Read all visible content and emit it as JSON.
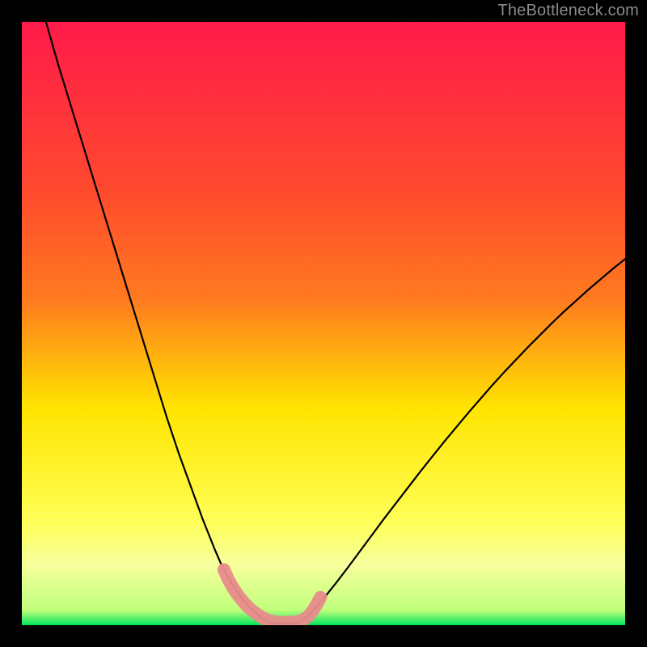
{
  "watermark": "TheBottleneck.com",
  "colors": {
    "bg": "#000000",
    "grad_top": "#ff1a4a",
    "grad_mid1": "#ff7a1f",
    "grad_mid2": "#ffe400",
    "grad_low": "#f6ff9a",
    "grad_bottom": "#00e55a",
    "curve": "#000000",
    "marker": "#e98b8b"
  },
  "chart_data": {
    "type": "line",
    "title": "",
    "xlabel": "",
    "ylabel": "",
    "xlim": [
      0,
      100
    ],
    "ylim": [
      0,
      100
    ],
    "series": [
      {
        "name": "left-curve",
        "x": [
          4,
          6,
          8,
          10,
          12,
          14,
          16,
          18,
          20,
          22,
          24,
          26,
          28,
          30,
          32,
          33,
          34,
          35,
          36,
          37,
          38,
          39,
          40,
          41
        ],
        "y": [
          100,
          93,
          86.5,
          80,
          73.5,
          67,
          60.5,
          54,
          47.5,
          41,
          34.5,
          28.5,
          23,
          17.5,
          12.5,
          10.2,
          8.3,
          6.6,
          5.1,
          3.8,
          2.7,
          1.8,
          1.0,
          0.6
        ]
      },
      {
        "name": "right-curve",
        "x": [
          46,
          47,
          48,
          49,
          50,
          52,
          54,
          56,
          58,
          60,
          62,
          64,
          66,
          68,
          70,
          72,
          74,
          76,
          78,
          80,
          82,
          84,
          86,
          88,
          90,
          92,
          94,
          96,
          98,
          100
        ],
        "y": [
          0.6,
          1.2,
          2.1,
          3.2,
          4.4,
          6.9,
          9.5,
          12.2,
          14.9,
          17.6,
          20.2,
          22.8,
          25.4,
          27.9,
          30.4,
          32.8,
          35.2,
          37.5,
          39.8,
          42.0,
          44.1,
          46.2,
          48.2,
          50.2,
          52.1,
          53.9,
          55.7,
          57.4,
          59.1,
          60.7
        ]
      },
      {
        "name": "floor",
        "x": [
          41,
          42,
          43,
          44,
          45,
          46
        ],
        "y": [
          0.4,
          0.3,
          0.3,
          0.3,
          0.3,
          0.4
        ]
      }
    ],
    "markers": [
      {
        "name": "left-threshold",
        "x": [
          33.5,
          34.2,
          35.0,
          35.8,
          36.6,
          37.4,
          38.2,
          39.0,
          39.8,
          40.5,
          41.2,
          42.0,
          43.0,
          44.0,
          45.2,
          46.2,
          47.0,
          47.7,
          48.3,
          48.9,
          49.5
        ],
        "y": [
          9.2,
          7.6,
          6.2,
          5.0,
          4.0,
          3.1,
          2.4,
          1.8,
          1.3,
          0.95,
          0.7,
          0.55,
          0.45,
          0.45,
          0.5,
          0.7,
          1.1,
          1.7,
          2.5,
          3.5,
          4.6
        ]
      }
    ]
  }
}
